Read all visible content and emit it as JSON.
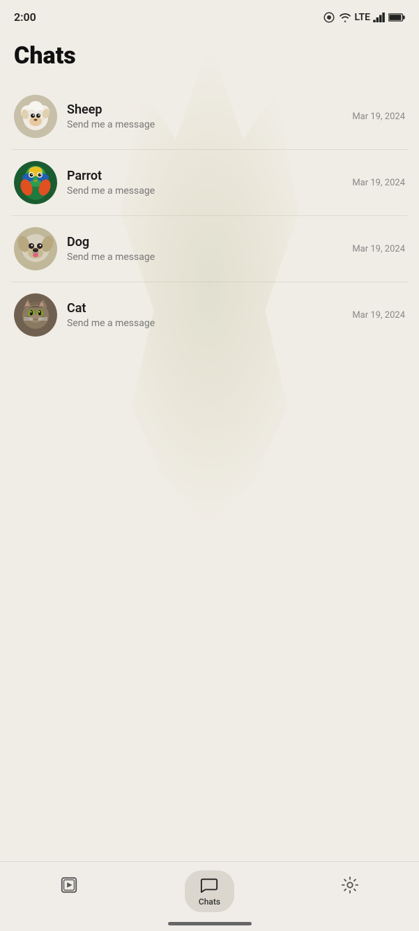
{
  "statusBar": {
    "time": "2:00",
    "cameraIcon": "camera-icon",
    "wifiIcon": "wifi-icon",
    "lteText": "LTE",
    "signalIcon": "signal-icon",
    "batteryIcon": "battery-icon"
  },
  "header": {
    "title": "Chats"
  },
  "chats": [
    {
      "id": "sheep",
      "name": "Sheep",
      "preview": "Send me a message",
      "date": "Mar 19, 2024",
      "avatarType": "sheep"
    },
    {
      "id": "parrot",
      "name": "Parrot",
      "preview": "Send me a message",
      "date": "Mar 19, 2024",
      "avatarType": "parrot"
    },
    {
      "id": "dog",
      "name": "Dog",
      "preview": "Send me a message",
      "date": "Mar 19, 2024",
      "avatarType": "dog"
    },
    {
      "id": "cat",
      "name": "Cat",
      "preview": "Send me a message",
      "date": "Mar 19, 2024",
      "avatarType": "cat"
    }
  ],
  "bottomNav": {
    "items": [
      {
        "id": "stories",
        "label": "",
        "active": false
      },
      {
        "id": "chats",
        "label": "Chats",
        "active": true
      },
      {
        "id": "settings",
        "label": "",
        "active": false
      }
    ]
  }
}
